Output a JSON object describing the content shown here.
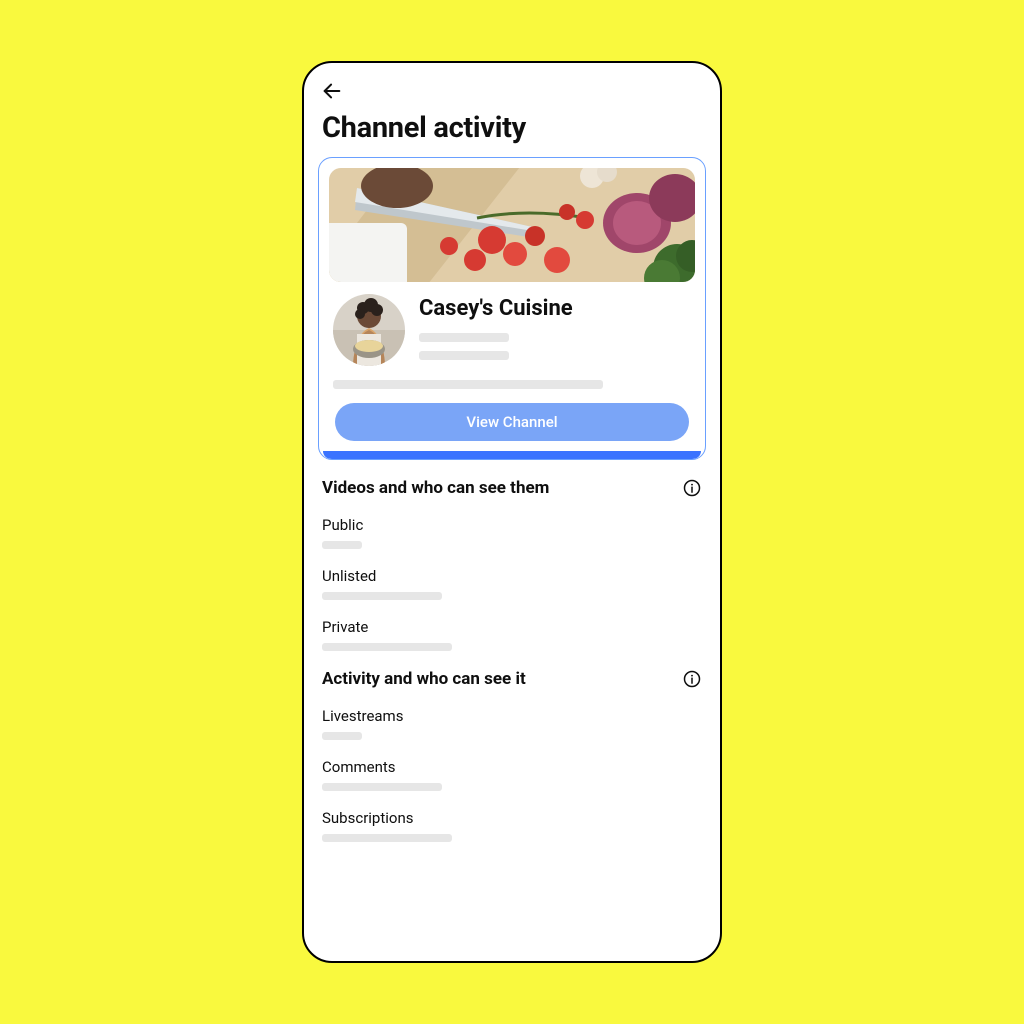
{
  "page": {
    "title": "Channel activity"
  },
  "channel": {
    "name": "Casey's Cuisine",
    "view_button_label": "View Channel"
  },
  "sections": {
    "videos": {
      "title": "Videos and who can see them",
      "items": {
        "public": "Public",
        "unlisted": "Unlisted",
        "private": "Private"
      }
    },
    "activity": {
      "title": "Activity and who can see it",
      "items": {
        "livestreams": "Livestreams",
        "comments": "Comments",
        "subscriptions": "Subscriptions"
      }
    }
  }
}
